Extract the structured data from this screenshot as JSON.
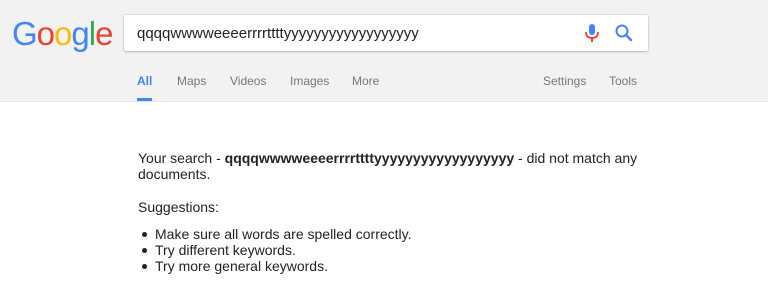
{
  "logo": {
    "letters": [
      {
        "ch": "G",
        "color": "#4285f4"
      },
      {
        "ch": "o",
        "color": "#ea4335"
      },
      {
        "ch": "o",
        "color": "#fbbc05"
      },
      {
        "ch": "g",
        "color": "#4285f4"
      },
      {
        "ch": "l",
        "color": "#34a853"
      },
      {
        "ch": "e",
        "color": "#ea4335"
      }
    ]
  },
  "search": {
    "value": "qqqqwwwweeeerrrrttttyyyyyyyyyyyyyyyyyy"
  },
  "tabs": {
    "all": "All",
    "maps": "Maps",
    "videos": "Videos",
    "images": "Images",
    "more": "More",
    "settings": "Settings",
    "tools": "Tools"
  },
  "result": {
    "prefix": "Your search - ",
    "query": "qqqqwwwweeeerrrrttttyyyyyyyyyyyyyyyyyy",
    "suffix": " - did not match any documents.",
    "suggestions_label": "Suggestions:",
    "suggestions": [
      "Make sure all words are spelled correctly.",
      "Try different keywords.",
      "Try more general keywords."
    ]
  },
  "colors": {
    "accent": "#4285f4",
    "mic_red": "#ea4335"
  },
  "icons": {
    "mic": "microphone-icon",
    "search": "magnifier-icon"
  }
}
